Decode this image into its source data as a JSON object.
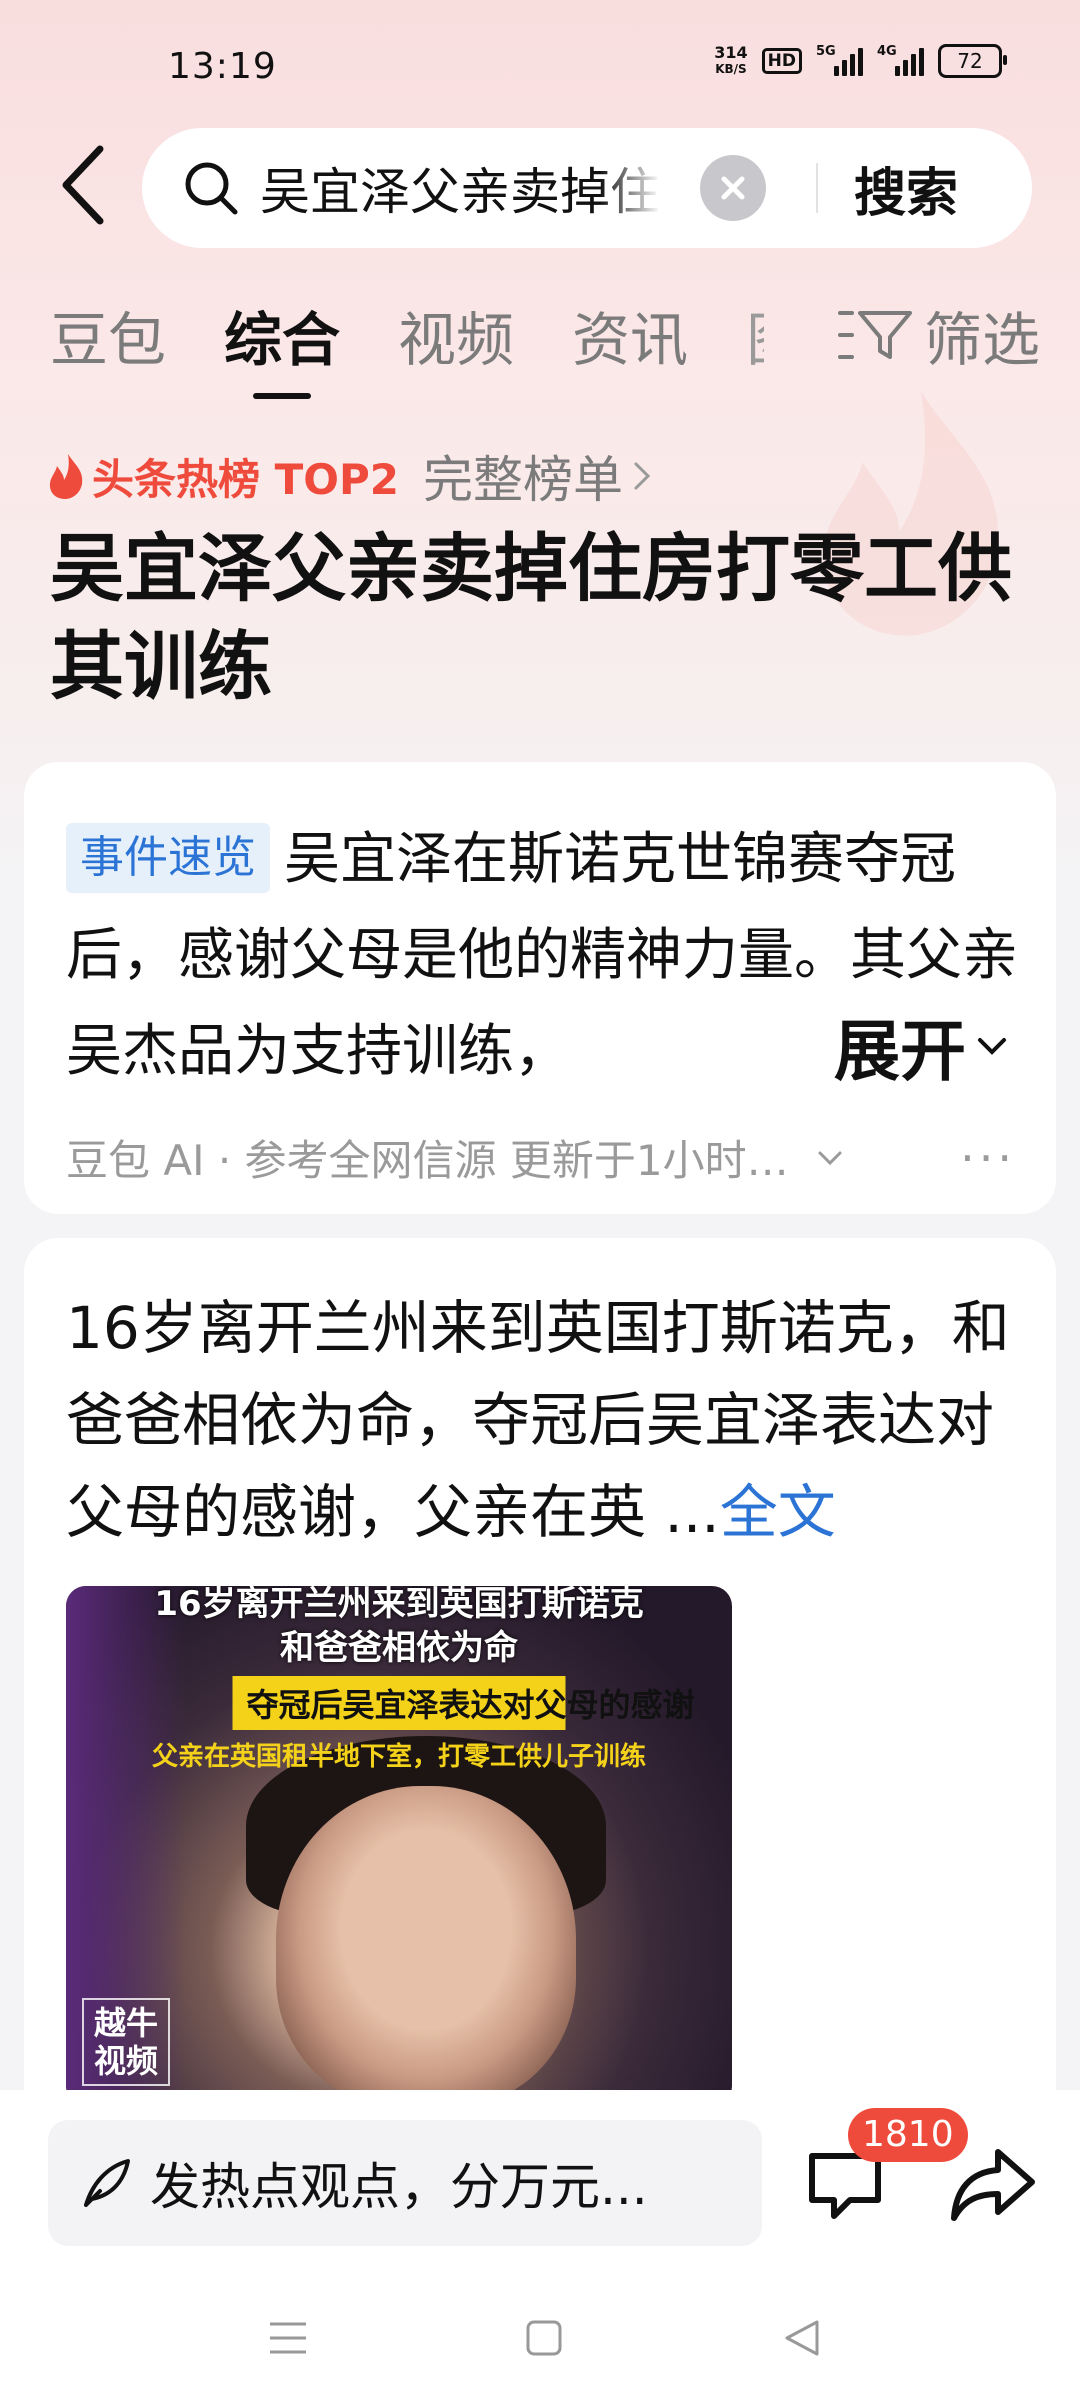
{
  "status_bar": {
    "time": "13:19",
    "net_speed": "314",
    "net_speed_unit": "KB/S",
    "hd_label": "HD",
    "signal1_label": "5G",
    "signal2_label": "4G",
    "battery": "72"
  },
  "search": {
    "query": "吴宜泽父亲卖掉住房打零工供其训练",
    "submit_label": "搜索"
  },
  "tabs": [
    {
      "label": "豆包"
    },
    {
      "label": "综合",
      "active": true
    },
    {
      "label": "视频"
    },
    {
      "label": "资讯"
    },
    {
      "label": "图"
    }
  ],
  "filter_label": "筛选",
  "hot": {
    "label": "头条热榜 TOP2",
    "full_list": "完整榜单"
  },
  "headline": "吴宜泽父亲卖掉住房打零工供其训练",
  "summary_card": {
    "tag": "事件速览",
    "text": "吴宜泽在斯诺克世锦赛夺冠后，感谢父母是他的精神力量。其父亲吴杰品为支持训练，",
    "expand_label": "展开",
    "source": "豆包 AI · 参考全网信源 更新于1小时…",
    "more": "···"
  },
  "article_card": {
    "text": "16岁离开兰州来到英国打斯诺克，和爸爸相依为命，夺冠后吴宜泽表达对父母的感谢，父亲在英 ...",
    "fulltext_label": "全文",
    "video": {
      "line1": "16岁离开兰州来到英国打斯诺克",
      "line2": "和爸爸相依为命",
      "line3": "夺冠后吴宜泽表达对父母的感谢",
      "line4": "父亲在英国租半地下室，打零工供儿子训练",
      "watermark": "越牛视频"
    }
  },
  "bottom_bar": {
    "comment_placeholder": "发热点观点，分万元...",
    "comment_count": "1810"
  },
  "colors": {
    "accent_red": "#ef4b3c",
    "link_blue": "#2b74d6",
    "tag_bg": "#e6f0fb"
  }
}
